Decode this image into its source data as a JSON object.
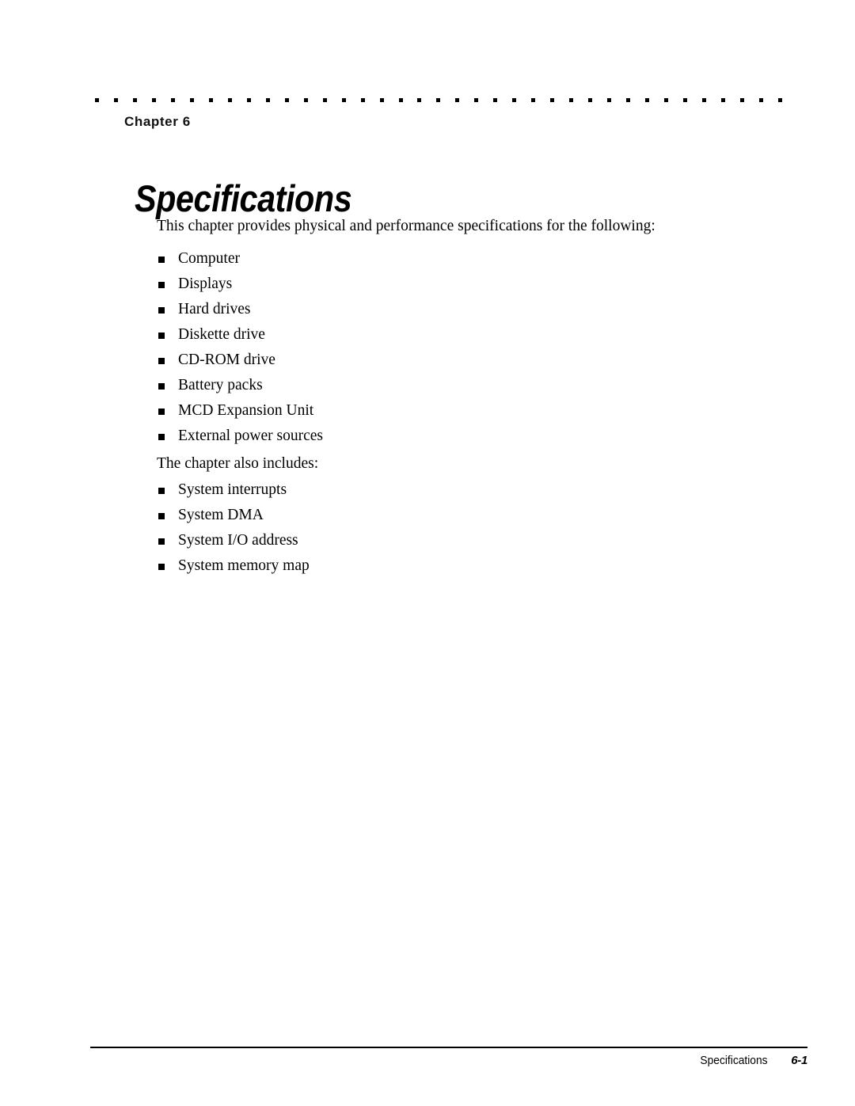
{
  "page": {
    "background_color": "#ffffff",
    "text_color": "#000000"
  },
  "header": {
    "dotted_rule": {
      "name": "dotted-rule",
      "dot_count": 37,
      "dot_color": "#000000"
    },
    "chapter_label": "Chapter 6"
  },
  "title": "Specifications",
  "content": {
    "intro_paragraph": "This chapter provides physical and performance specifications for the following:",
    "primary_list": [
      "Computer",
      "Displays",
      "Hard drives",
      "Diskette drive",
      "CD-ROM drive",
      "Battery packs",
      "MCD Expansion Unit",
      "External power sources"
    ],
    "secondary_intro": "The chapter also includes:",
    "secondary_list": [
      "System interrupts",
      "System DMA",
      "System I/O address",
      "System memory map"
    ]
  },
  "footer": {
    "chapter_name": "Specifications",
    "page_number": "6-1"
  }
}
